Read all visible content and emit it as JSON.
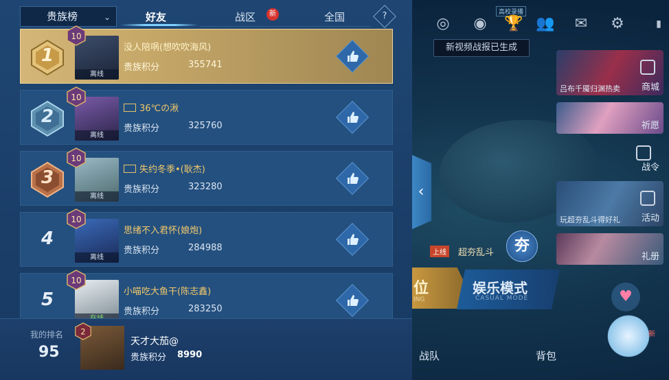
{
  "tabs": {
    "dropdown_label": "贵族榜",
    "items": [
      {
        "label": "好友",
        "active": true
      },
      {
        "label": "战区",
        "badge": "新"
      },
      {
        "label": "全国"
      }
    ],
    "help_label": "?"
  },
  "score_label": "贵族积分",
  "rows": [
    {
      "rank": "1",
      "level": "10",
      "name": "没人陪㖞(想吹吹海风)",
      "score": "355741",
      "status": "离线"
    },
    {
      "rank": "2",
      "level": "10",
      "name": "36℃の湫",
      "score": "325760",
      "status": "离线",
      "team_icon": true
    },
    {
      "rank": "3",
      "level": "10",
      "name": "失约冬季•(耿杰)",
      "score": "323280",
      "status": "离线",
      "team_icon": true
    },
    {
      "rank": "4",
      "level": "10",
      "name": "思绪不入君怀(娘炮)",
      "score": "284988",
      "status": "离线"
    },
    {
      "rank": "5",
      "level": "10",
      "name": "小喵吃大鱼干(陈志鑫)",
      "score": "283250",
      "status": "在线"
    }
  ],
  "me": {
    "label": "我的排名",
    "rank": "95",
    "level": "2",
    "name": "天才大茄@",
    "score_label": "贵族积分",
    "score": "8990"
  },
  "lobby": {
    "rank_tag": "高校录播",
    "tooltip": "新视频战报已生成",
    "side_items": [
      {
        "caption": "吕布千魇归渊热卖",
        "label": "商城"
      },
      {
        "caption": "",
        "label": "祈愿"
      },
      {
        "caption": "",
        "label": "战令"
      },
      {
        "caption": "玩超夯乱斗得好礼",
        "label": "活动"
      },
      {
        "caption": "",
        "label": "礼册"
      }
    ],
    "event_tag": "上线",
    "event_name": "超夯乱斗",
    "mode_circle": "夯",
    "rank_button": {
      "title": "位",
      "sub": "ING"
    },
    "mode_button": {
      "title": "娱乐模式",
      "sub": "CASUAL MODE"
    },
    "bottom_nav": [
      "战队",
      "背包"
    ],
    "new_tag": "新"
  },
  "colors": {
    "gold_name": "#f2c96a",
    "panel_bg": "#1f4673",
    "row_bg": "#24507f",
    "first_row": "#c5a768"
  }
}
